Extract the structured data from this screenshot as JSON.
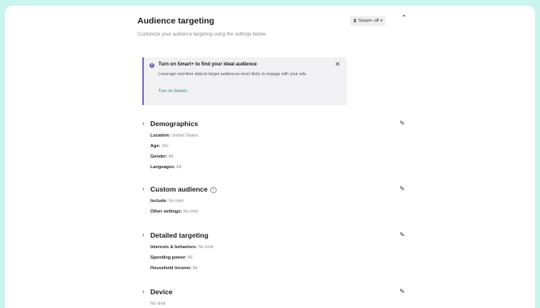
{
  "header": {
    "title": "Audience targeting",
    "subtitle": "Customize your audience targeting using the settings below.",
    "smart_badge": "Smart+ off",
    "badge_icon": "hourglass-icon",
    "collapse_icon": "chevron-up-icon"
  },
  "notice": {
    "title": "Turn on Smart+ to find your ideal audience",
    "body": "Leverage real-time data to target audiences most likely to engage with your ads.",
    "link": "Turn on Smart+",
    "accent": "#7b69c9",
    "link_color": "#2d7f6f"
  },
  "sections": [
    {
      "title": "Demographics",
      "rows": [
        {
          "label": "Location:",
          "value": "United States"
        },
        {
          "label": "Age:",
          "value": "18+"
        },
        {
          "label": "Gender:",
          "value": "All"
        },
        {
          "label": "Languages:",
          "value": "All"
        }
      ]
    },
    {
      "title": "Custom audience",
      "rows": [
        {
          "label": "Include:",
          "value": "No limit"
        },
        {
          "label": "Other settings:",
          "value": "No limit"
        }
      ]
    },
    {
      "title": "Detailed targeting",
      "rows": [
        {
          "label": "Interests & behaviors:",
          "value": "No limit"
        },
        {
          "label": "Spending power:",
          "value": "All"
        },
        {
          "label": "Household income:",
          "value": "All"
        }
      ]
    },
    {
      "title": "Device",
      "rows": [
        {
          "label": "",
          "value": "No limit"
        }
      ]
    }
  ],
  "colors": {
    "background": "#c9f5ee",
    "panel": "#ffffff"
  }
}
